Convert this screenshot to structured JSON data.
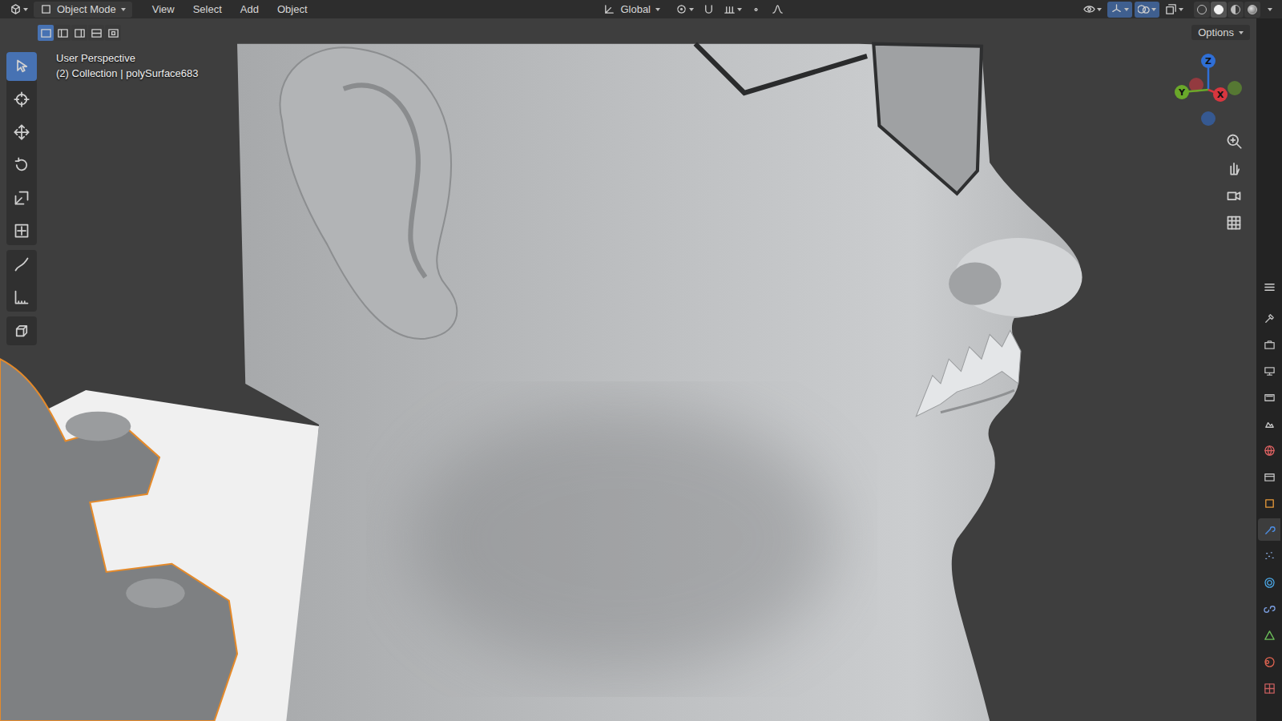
{
  "header": {
    "mode": "Object Mode",
    "menus": [
      "View",
      "Select",
      "Add",
      "Object"
    ],
    "orientation": "Global",
    "toggles": [
      {
        "kind": "visibility",
        "on": false
      },
      {
        "kind": "gizmo",
        "on": true
      },
      {
        "kind": "overlay",
        "on": true
      },
      {
        "kind": "xray",
        "on": false
      }
    ],
    "shading_modes": [
      {
        "kind": "wireframe",
        "selected": false
      },
      {
        "kind": "solid",
        "selected": true
      },
      {
        "kind": "material",
        "selected": false
      },
      {
        "kind": "rendered",
        "selected": false
      }
    ]
  },
  "select_modes": [
    {
      "selected": true
    },
    {
      "selected": false
    },
    {
      "selected": false
    },
    {
      "selected": false
    },
    {
      "selected": false
    }
  ],
  "options": "Options",
  "viewport": {
    "info": [
      "User Perspective",
      "(2) Collection | polySurface683"
    ]
  },
  "tool_groups": [
    [
      {
        "kind": "select",
        "selected": true
      },
      {
        "kind": "cursor",
        "selected": false
      },
      {
        "kind": "move",
        "selected": false
      },
      {
        "kind": "rotate",
        "selected": false
      },
      {
        "kind": "scale",
        "selected": false
      },
      {
        "kind": "transform",
        "selected": false
      }
    ],
    [
      {
        "kind": "annotate",
        "selected": false
      },
      {
        "kind": "measure",
        "selected": false
      }
    ],
    [
      {
        "kind": "add_cube",
        "selected": false
      }
    ]
  ],
  "gizmo_axes": [
    {
      "label": "Z",
      "color": "#2f6fd6"
    },
    {
      "label": "Y",
      "color": "#6aa82a"
    },
    {
      "label": "X",
      "color": "#d8363f"
    }
  ],
  "nav_buttons": [
    {
      "kind": "zoom"
    },
    {
      "kind": "pan"
    },
    {
      "kind": "camera"
    },
    {
      "kind": "ortho"
    }
  ],
  "properties_tabs": [
    {
      "kind": "tool",
      "selected": false
    },
    {
      "kind": "render",
      "selected": false
    },
    {
      "kind": "output",
      "selected": false
    },
    {
      "kind": "view_layer",
      "selected": false
    },
    {
      "kind": "scene",
      "selected": false
    },
    {
      "kind": "world",
      "selected": false
    },
    {
      "kind": "collection",
      "selected": false
    },
    {
      "kind": "object",
      "selected": false
    },
    {
      "kind": "modifier",
      "selected": true
    },
    {
      "kind": "particles",
      "selected": false
    },
    {
      "kind": "physics",
      "selected": false
    },
    {
      "kind": "constraints",
      "selected": false
    },
    {
      "kind": "data",
      "selected": false
    },
    {
      "kind": "material",
      "selected": false
    },
    {
      "kind": "texture",
      "selected": false
    }
  ]
}
